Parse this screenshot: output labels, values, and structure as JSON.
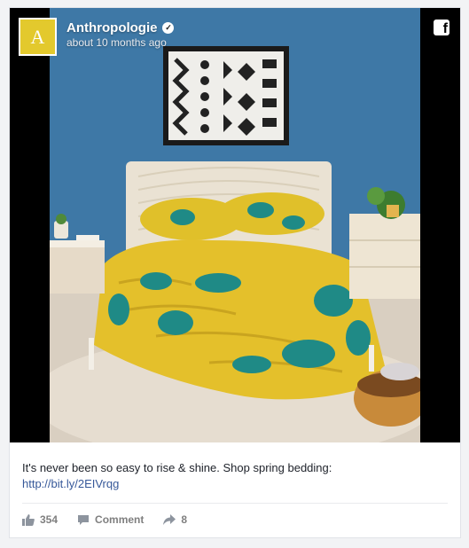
{
  "post": {
    "page_name": "Anthropologie",
    "avatar_letter": "A",
    "timestamp": "about 10 months ago",
    "caption_text": "It's never been so easy to rise & shine. Shop spring bedding:",
    "caption_link": "http://bit.ly/2EIVrqg"
  },
  "actions": {
    "like_count": "354",
    "comment_label": "Comment",
    "share_count": "8"
  },
  "icons": {
    "verified": "verified-badge-icon",
    "facebook": "facebook-logo-icon",
    "like": "thumbs-up-icon",
    "comment": "speech-bubble-icon",
    "share": "share-arrow-icon"
  },
  "colors": {
    "wall": "#3e78a6",
    "avatar_bg": "#e3c92d",
    "link": "#365899",
    "action_text": "#7f7f7f"
  }
}
